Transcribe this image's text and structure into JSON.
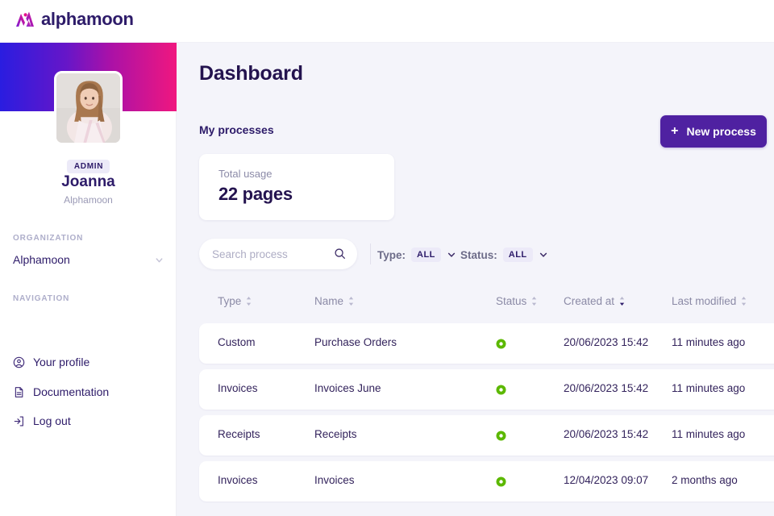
{
  "topbar": {
    "brand": "alphamoon",
    "logo_icon": "alphamoon-logo-mark"
  },
  "sidebar": {
    "user": {
      "role_badge": "ADMIN",
      "name": "Joanna",
      "organization": "Alphamoon"
    },
    "organization": {
      "label": "ORGANIZATION",
      "value": "Alphamoon",
      "chevron_icon": "chevron-down-icon"
    },
    "navigation": {
      "label": "NAVIGATION",
      "items": [
        {
          "label": "Your profile",
          "icon": "user-circle-icon"
        },
        {
          "label": "Documentation",
          "icon": "document-icon"
        },
        {
          "label": "Log out",
          "icon": "logout-icon"
        }
      ]
    }
  },
  "main": {
    "page_title": "Dashboard",
    "section_title": "My processes",
    "new_process_button": {
      "label": "New process",
      "icon": "plus-icon"
    },
    "usage_card": {
      "label": "Total usage",
      "value": "22 pages"
    },
    "search": {
      "placeholder": "Search process",
      "value": "",
      "icon": "search-icon"
    },
    "filters": [
      {
        "label": "Type:",
        "value": "ALL",
        "chevron_icon": "chevron-down-icon"
      },
      {
        "label": "Status:",
        "value": "ALL",
        "chevron_icon": "chevron-down-icon"
      }
    ],
    "table": {
      "columns": [
        {
          "label": "Type",
          "sort_icon": "sort-chevrons-icon"
        },
        {
          "label": "Name",
          "sort_icon": "sort-chevrons-icon"
        },
        {
          "label": "Status",
          "sort_icon": "sort-chevrons-icon"
        },
        {
          "label": "Created at",
          "sort_icon": "sort-chevrons-icon",
          "active_sort": "desc"
        },
        {
          "label": "Last modified",
          "sort_icon": "sort-chevrons-icon"
        }
      ],
      "rows": [
        {
          "type": "Custom",
          "name": "Purchase Orders",
          "status": "active",
          "created_at": "20/06/2023 15:42",
          "last_modified": "11 minutes ago"
        },
        {
          "type": "Invoices",
          "name": "Invoices June",
          "status": "active",
          "created_at": "20/06/2023 15:42",
          "last_modified": "11 minutes ago"
        },
        {
          "type": "Receipts",
          "name": "Receipts",
          "status": "active",
          "created_at": "20/06/2023 15:42",
          "last_modified": "11 minutes ago"
        },
        {
          "type": "Invoices",
          "name": "Invoices",
          "status": "active",
          "created_at": "12/04/2023 09:07",
          "last_modified": "2 months ago"
        }
      ]
    }
  },
  "colors": {
    "brand_purple": "#4f21a1",
    "navy_text": "#2d1b69",
    "status_green": "#5cb800",
    "banner_gradient_start": "#2a1de0",
    "banner_gradient_end": "#f0177f",
    "app_background": "#f4f4fa",
    "badge_background": "#eceaf8"
  }
}
